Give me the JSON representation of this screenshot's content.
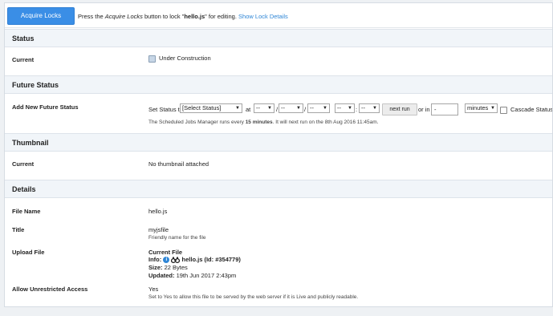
{
  "toolbar": {
    "acquire_label": "Acquire Locks",
    "msg_pre": "Press the ",
    "msg_em": "Acquire Locks",
    "msg_mid": " button to lock \"",
    "msg_file": "hello.js",
    "msg_post": "\" for editing.",
    "show_lock_details": "Show Lock Details"
  },
  "status": {
    "heading": "Status",
    "current_label": "Current",
    "current_value": "Under Construction"
  },
  "future_status": {
    "heading": "Future Status",
    "add_label": "Add New Future Status",
    "set_status_to": "Set Status to",
    "status_select": "[Select Status]",
    "at": "at",
    "dash": "--",
    "slash1": "/",
    "slash2": "/",
    "colon": ":",
    "next_run": "next run",
    "or_in": "or in",
    "minutes_value": "-",
    "minutes_unit": "minutes",
    "cascade_label": "Cascade Status Cha",
    "hint_pre": "The Scheduled Jobs Manager runs every ",
    "hint_bold": "15 minutes",
    "hint_post": ". It will next run on the 8th Aug 2016 11:45am."
  },
  "thumbnail": {
    "heading": "Thumbnail",
    "current_label": "Current",
    "current_value": "No thumbnail attached"
  },
  "details": {
    "heading": "Details",
    "file_name_label": "File Name",
    "file_name_value": "hello.js",
    "title_label": "Title",
    "title_value": "myjsfile",
    "title_hint": "Friendly name for the file",
    "upload_label": "Upload File",
    "current_file": "Current File",
    "info_label": "Info:",
    "info_value": "hello.js (Id: #354779)",
    "size_label": "Size:",
    "size_value": "22 Bytes",
    "updated_label": "Updated:",
    "updated_value": "19th Jun 2017 2:43pm",
    "unrestricted_label": "Allow Unrestricted Access",
    "unrestricted_value": "Yes",
    "unrestricted_hint": "Set to Yes to allow this file to be served by the web server if it is Live and publicly readable."
  },
  "colors": {
    "accent": "#3a8ee6",
    "link": "#2f86d6",
    "section_bg": "#f1f5f9"
  }
}
